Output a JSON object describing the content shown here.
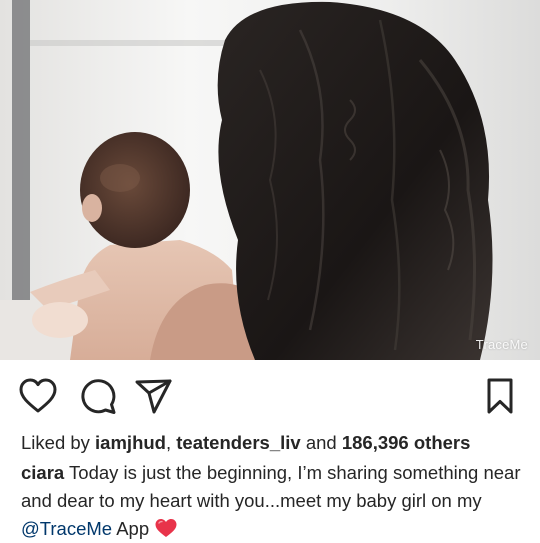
{
  "post": {
    "watermark": "TraceMe",
    "likes": {
      "prefix": "Liked by ",
      "user1": "iamjhud",
      "separator": ", ",
      "user2": "teatenders_liv",
      "and": " and ",
      "others": "186,396 others"
    },
    "caption": {
      "username": "ciara",
      "text": " Today is just the beginning, I’m sharing something near and dear to my heart with you...meet my baby girl on my ",
      "mention": "@TraceMe",
      "suffix": " App "
    }
  },
  "icons": {
    "like": "heart-outline-icon",
    "comment": "comment-bubble-icon",
    "share": "paper-plane-icon",
    "save": "bookmark-icon",
    "emoji": "red-heart-emoji"
  },
  "colors": {
    "text": "#262626",
    "mention": "#00376b",
    "emoji_heart": "#e8334a"
  }
}
